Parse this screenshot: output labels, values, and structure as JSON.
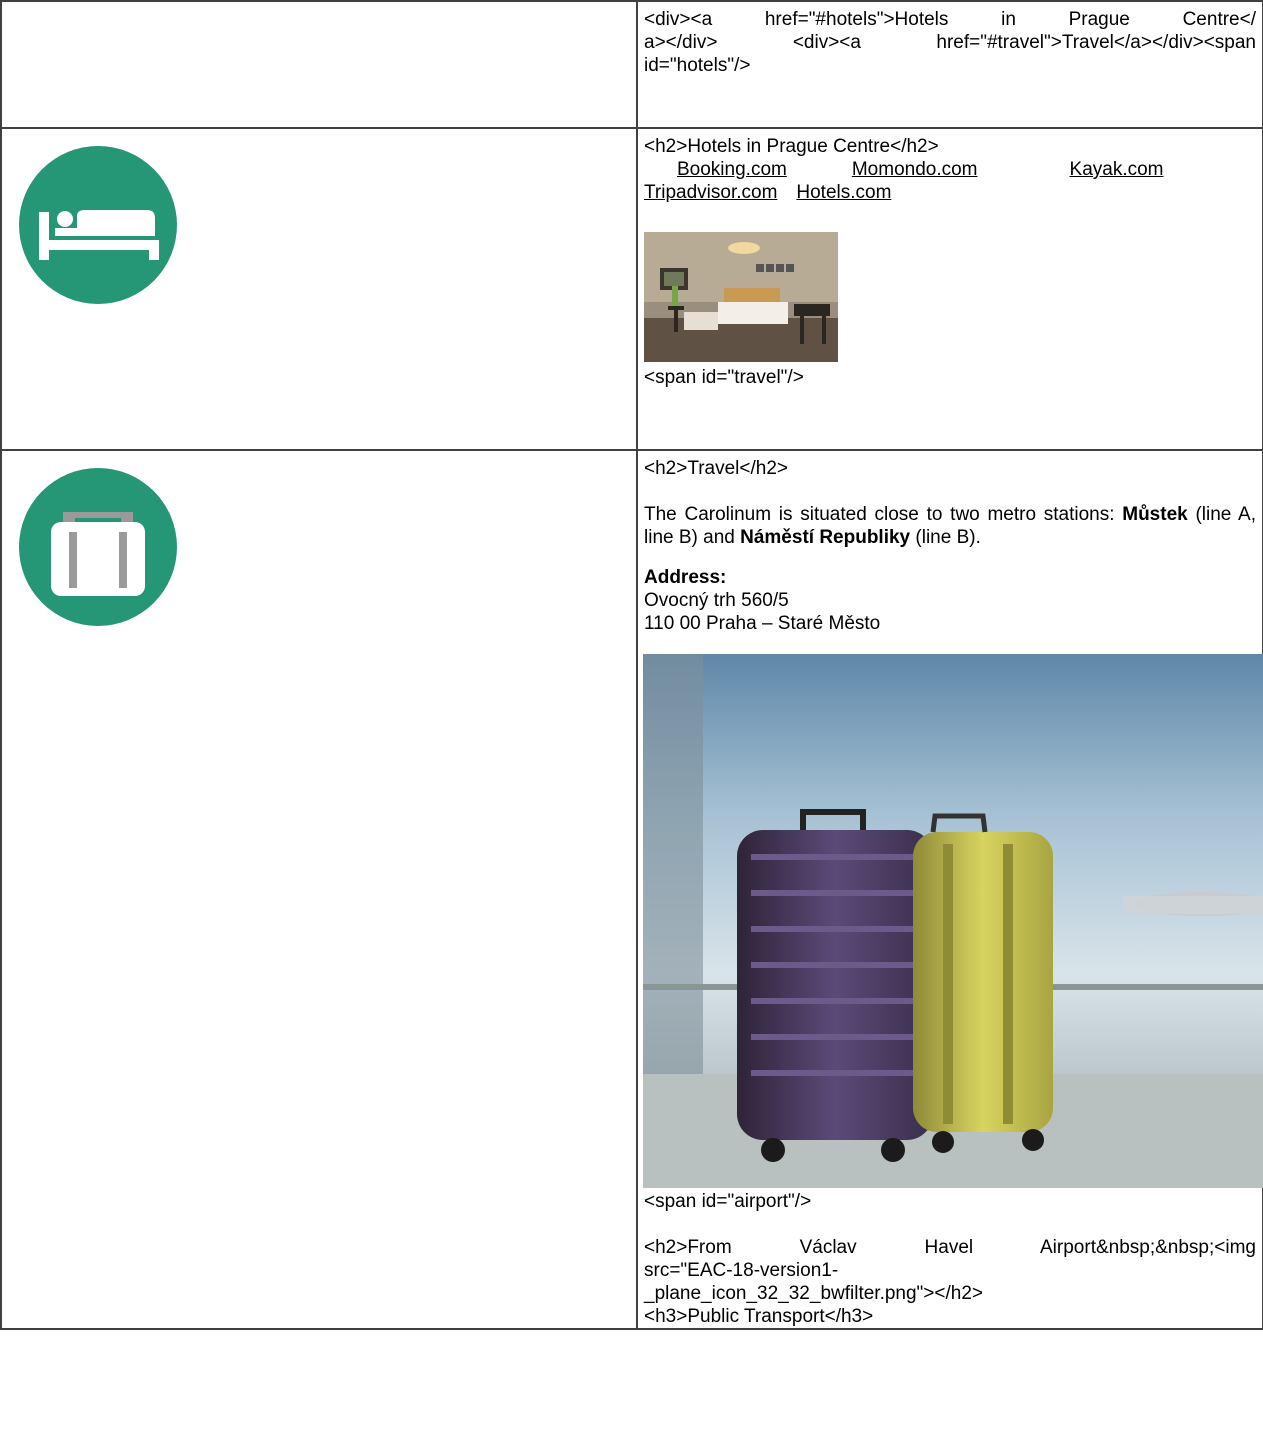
{
  "row1": {
    "lines": [
      "<div><a href=\"#hotels\">Hotels in Prague Centre</",
      "a></div> <div><a href=\"#travel\">Travel</a></div><span",
      "id=\"hotels\"/>"
    ]
  },
  "row2": {
    "icon": "bed-icon",
    "icon_color": "#259676",
    "heading_markup": "<h2>Hotels in Prague Centre</h2>",
    "links": [
      "Booking.com",
      "Momondo.com",
      "Kayak.com",
      "Tripadvisor.com",
      "Hotels.com"
    ],
    "photo_label": "hotel-room-photo",
    "span_markup": "<span id=\"travel\"/>"
  },
  "row3": {
    "icon": "suitcase-icon",
    "icon_color": "#259676",
    "heading_markup": "<h2>Travel</h2>",
    "intro_1": "The Carolinum is situated close to two metro stations: ",
    "station_1": "Můstek",
    "intro_2": " (line A, line B) and ",
    "station_2": "Náměstí Republiky",
    "intro_3": " (line B).",
    "address_label": "Address:",
    "address_line1": "Ovocný trh 560/5",
    "address_line2": "110 00 Praha – Staré Město",
    "photo_label": "luggage-airport-photo",
    "span_airport": "<span id=\"airport\"/>",
    "airport_heading_1": "<h2>From Václav Havel Airport&nbsp;&nbsp;<img",
    "airport_heading_2": "src=\"EAC-18-version1-",
    "airport_heading_3": "_plane_icon_32_32_bwfilter.png\"></h2>",
    "h3_markup": "<h3>Public Transport</h3>"
  }
}
